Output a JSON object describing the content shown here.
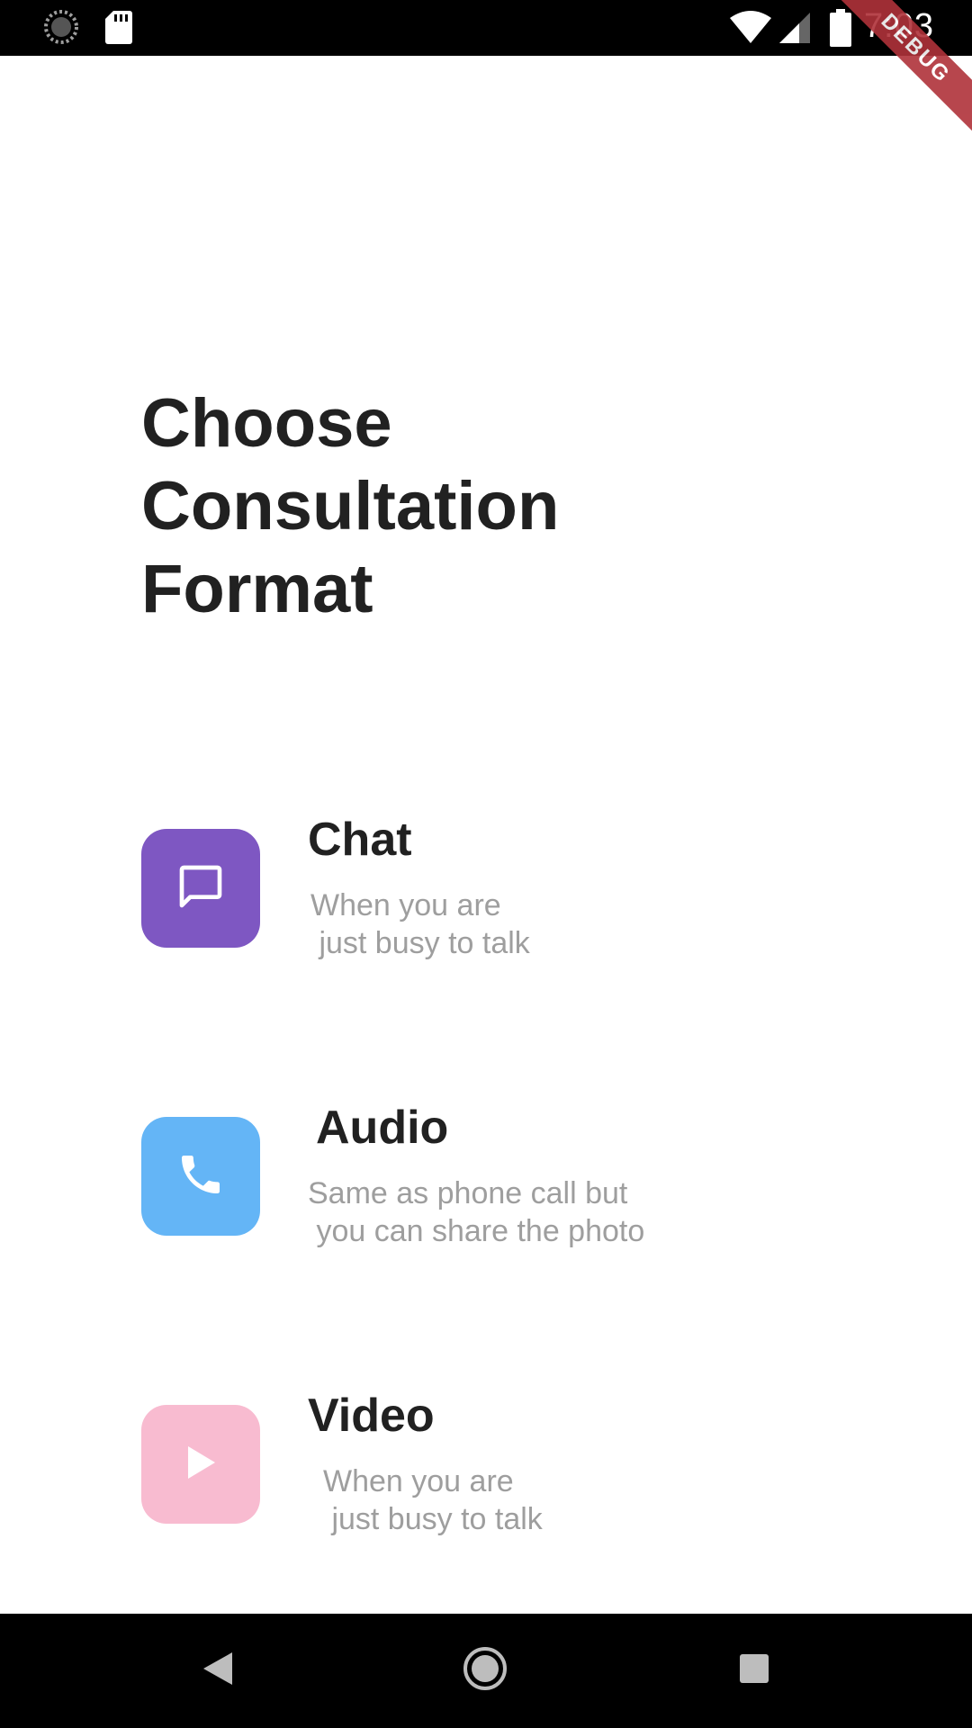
{
  "status_bar": {
    "time": "7:03",
    "icons": [
      "sync-icon",
      "sd-card-icon",
      "wifi-icon",
      "signal-icon",
      "battery-icon"
    ]
  },
  "debug_banner": "DEBUG",
  "title": "Choose\nConsultation\nFormat",
  "options": [
    {
      "title": "Chat",
      "description": "When you are\n just busy to talk",
      "icon": "chat-bubble-icon",
      "color": "#7e57c2"
    },
    {
      "title": "Audio",
      "description": "Same as phone call but\n you can share the photo",
      "icon": "phone-icon",
      "color": "#64b5f6"
    },
    {
      "title": "Video",
      "description": "When you are\n just busy to talk",
      "icon": "play-icon",
      "color": "#f8bbd0"
    }
  ],
  "nav_bar": {
    "buttons": [
      "back",
      "home",
      "recents"
    ]
  }
}
